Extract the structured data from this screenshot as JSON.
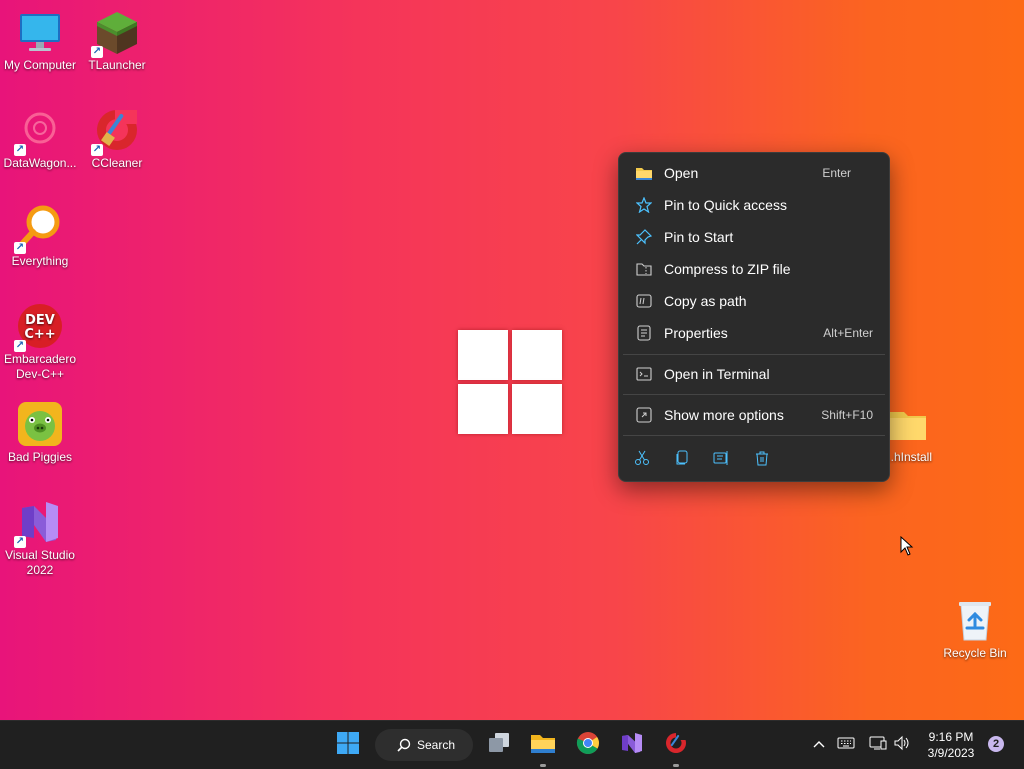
{
  "desktop": {
    "icons": [
      {
        "label": "My Computer"
      },
      {
        "label": "TLauncher"
      },
      {
        "label": "DataWagon..."
      },
      {
        "label": "CCleaner"
      },
      {
        "label": "Everything"
      },
      {
        "label": "Embarcadero Dev-C++"
      },
      {
        "label": "Bad Piggies"
      },
      {
        "label": "Visual Studio 2022"
      },
      {
        "label": "...hInstall"
      },
      {
        "label": "Recycle Bin"
      }
    ]
  },
  "context_menu": {
    "items": [
      {
        "label": "Open",
        "shortcut": "Enter",
        "icon": "folder-icon"
      },
      {
        "label": "Pin to Quick access",
        "shortcut": "",
        "icon": "star-icon"
      },
      {
        "label": "Pin to Start",
        "shortcut": "",
        "icon": "pin-icon"
      },
      {
        "label": "Compress to ZIP file",
        "shortcut": "",
        "icon": "zip-icon"
      },
      {
        "label": "Copy as path",
        "shortcut": "",
        "icon": "copy-path-icon"
      },
      {
        "label": "Properties",
        "shortcut": "Alt+Enter",
        "icon": "properties-icon"
      },
      {
        "label": "Open in Terminal",
        "shortcut": "",
        "icon": "terminal-icon"
      },
      {
        "label": "Show more options",
        "shortcut": "Shift+F10",
        "icon": "more-options-icon"
      }
    ],
    "toolbar": [
      "cut-icon",
      "copy-icon",
      "rename-icon",
      "delete-icon"
    ],
    "accent": "#4cc2ff"
  },
  "taskbar": {
    "search_label": "Search",
    "apps": [
      "start-icon",
      "search-icon",
      "task-view-icon",
      "file-explorer-icon",
      "chrome-icon",
      "visual-studio-icon",
      "ccleaner-icon"
    ],
    "tray": [
      "chevron-up-icon",
      "keyboard-icon",
      "network-icon",
      "volume-icon"
    ],
    "clock": {
      "time": "9:16 PM",
      "date": "3/9/2023"
    },
    "notification_count": "2"
  }
}
